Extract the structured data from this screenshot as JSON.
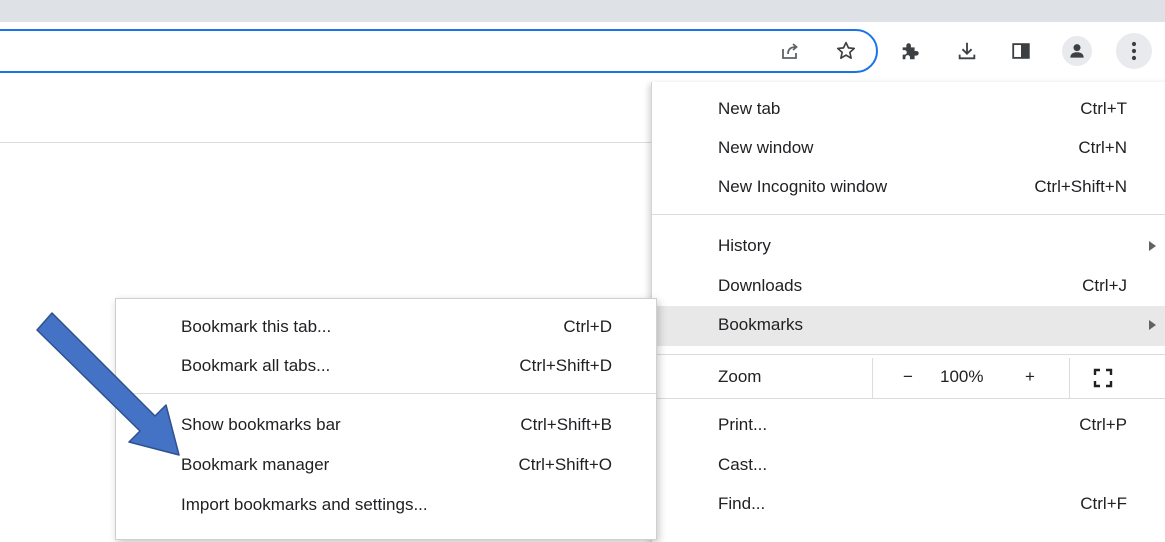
{
  "toolbar": {
    "icons": [
      "share-icon",
      "bookmark-star-icon",
      "extensions-puzzle-icon",
      "download-icon",
      "side-panel-icon",
      "profile-avatar-icon",
      "chrome-menu-icon"
    ]
  },
  "main_menu": {
    "items": [
      {
        "label": "New tab",
        "shortcut": "Ctrl+T"
      },
      {
        "label": "New window",
        "shortcut": "Ctrl+N"
      },
      {
        "label": "New Incognito window",
        "shortcut": "Ctrl+Shift+N"
      },
      {
        "label": "History",
        "shortcut": ""
      },
      {
        "label": "Downloads",
        "shortcut": "Ctrl+J"
      },
      {
        "label": "Bookmarks",
        "shortcut": ""
      },
      {
        "label": "Print...",
        "shortcut": "Ctrl+P"
      },
      {
        "label": "Cast...",
        "shortcut": ""
      },
      {
        "label": "Find...",
        "shortcut": "Ctrl+F"
      }
    ],
    "zoom": {
      "label": "Zoom",
      "minus": "−",
      "value": "100%",
      "plus": "+"
    }
  },
  "bookmarks_submenu": {
    "items": [
      {
        "label": "Bookmark this tab...",
        "shortcut": "Ctrl+D"
      },
      {
        "label": "Bookmark all tabs...",
        "shortcut": "Ctrl+Shift+D"
      },
      {
        "label": "Show bookmarks bar",
        "shortcut": "Ctrl+Shift+B"
      },
      {
        "label": "Bookmark manager",
        "shortcut": "Ctrl+Shift+O"
      },
      {
        "label": "Import bookmarks and settings...",
        "shortcut": ""
      }
    ]
  },
  "colors": {
    "focus_ring": "#1a73e8",
    "highlight": "#e8e8e8",
    "annotation_arrow": "#4472c4"
  }
}
